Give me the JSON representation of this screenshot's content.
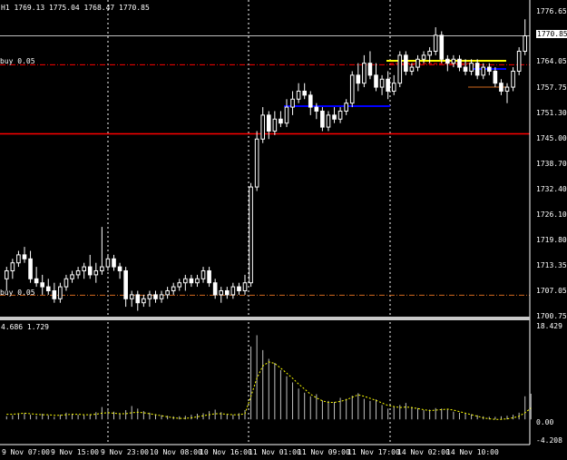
{
  "main": {
    "ohlc_label": "H1  1769.13 1775.04 1768.47 1770.85",
    "order_label_top": "buy 0.05",
    "order_label_bottom": "buy 0.05",
    "current_price": "1770.85",
    "price_ticks": [
      "1776.65",
      "1764.05",
      "1757.75",
      "1751.30",
      "1745.00",
      "1738.70",
      "1732.40",
      "1726.10",
      "1719.80",
      "1713.35",
      "1707.05",
      "1700.75"
    ]
  },
  "indicator": {
    "label": "4.686 1.729",
    "ticks": [
      "18.429",
      "0.00",
      "-4.208"
    ]
  },
  "time_ticks": [
    "9 Nov 07:00",
    "9 Nov 15:00",
    "9 Nov 23:00",
    "10 Nov 08:00",
    "10 Nov 16:00",
    "11 Nov 01:00",
    "11 Nov 09:00",
    "11 Nov 17:00",
    "14 Nov 02:00",
    "14 Nov 10:00"
  ],
  "colors": {
    "background": "#000000",
    "candle": "#ffffff",
    "grid_separator": "#ffffff",
    "red_level": "#ff0000",
    "blue_level": "#0000ff",
    "yellow_level": "#ffff00",
    "brown_level": "#8b4513",
    "orange_dashdot": "#d2691e",
    "indicator_line": "#ffff00",
    "indicator_hist": "#c0c0c0"
  },
  "chart_data": {
    "type": "candlestick",
    "symbol_timeframe": "H1",
    "price_range": [
      1700.75,
      1776.65
    ],
    "horizontal_levels": [
      {
        "price": 1770.85,
        "color": "#c0c0c0",
        "style": "solid"
      },
      {
        "price": 1763.6,
        "color": "#ff0000",
        "style": "dash-dot"
      },
      {
        "price": 1746.3,
        "color": "#ff0000",
        "style": "solid"
      },
      {
        "price": 1705.9,
        "color": "#d2691e",
        "style": "dash-dot"
      }
    ],
    "candles": [
      {
        "o": 1710,
        "h": 1713,
        "l": 1707,
        "c": 1712
      },
      {
        "o": 1712,
        "h": 1715,
        "l": 1710,
        "c": 1714
      },
      {
        "o": 1714,
        "h": 1717,
        "l": 1713,
        "c": 1716
      },
      {
        "o": 1716,
        "h": 1718,
        "l": 1714,
        "c": 1715
      },
      {
        "o": 1715,
        "h": 1717,
        "l": 1709,
        "c": 1710
      },
      {
        "o": 1710,
        "h": 1713,
        "l": 1708,
        "c": 1709
      },
      {
        "o": 1709,
        "h": 1711,
        "l": 1706,
        "c": 1708
      },
      {
        "o": 1708,
        "h": 1710,
        "l": 1706,
        "c": 1707
      },
      {
        "o": 1707,
        "h": 1709,
        "l": 1704,
        "c": 1705
      },
      {
        "o": 1705,
        "h": 1709,
        "l": 1704,
        "c": 1708
      },
      {
        "o": 1708,
        "h": 1711,
        "l": 1707,
        "c": 1710
      },
      {
        "o": 1710,
        "h": 1712,
        "l": 1709,
        "c": 1711
      },
      {
        "o": 1711,
        "h": 1713,
        "l": 1710,
        "c": 1712
      },
      {
        "o": 1712,
        "h": 1714,
        "l": 1710,
        "c": 1713
      },
      {
        "o": 1713,
        "h": 1716,
        "l": 1710,
        "c": 1711
      },
      {
        "o": 1711,
        "h": 1714,
        "l": 1709,
        "c": 1712
      },
      {
        "o": 1712,
        "h": 1723,
        "l": 1711,
        "c": 1713
      },
      {
        "o": 1713,
        "h": 1716,
        "l": 1712,
        "c": 1715
      },
      {
        "o": 1715,
        "h": 1716,
        "l": 1712,
        "c": 1713
      },
      {
        "o": 1713,
        "h": 1714,
        "l": 1710,
        "c": 1712
      },
      {
        "o": 1712,
        "h": 1713,
        "l": 1703,
        "c": 1705
      },
      {
        "o": 1705,
        "h": 1707,
        "l": 1703,
        "c": 1706
      },
      {
        "o": 1706,
        "h": 1707,
        "l": 1702,
        "c": 1704
      },
      {
        "o": 1704,
        "h": 1706,
        "l": 1703,
        "c": 1705
      },
      {
        "o": 1705,
        "h": 1707,
        "l": 1703,
        "c": 1706
      },
      {
        "o": 1706,
        "h": 1707,
        "l": 1704,
        "c": 1705
      },
      {
        "o": 1705,
        "h": 1707,
        "l": 1704,
        "c": 1706
      },
      {
        "o": 1706,
        "h": 1708,
        "l": 1705,
        "c": 1707
      },
      {
        "o": 1707,
        "h": 1709,
        "l": 1706,
        "c": 1708
      },
      {
        "o": 1708,
        "h": 1710,
        "l": 1707,
        "c": 1709
      },
      {
        "o": 1709,
        "h": 1711,
        "l": 1707,
        "c": 1710
      },
      {
        "o": 1710,
        "h": 1711,
        "l": 1708,
        "c": 1709
      },
      {
        "o": 1709,
        "h": 1711,
        "l": 1708,
        "c": 1710
      },
      {
        "o": 1710,
        "h": 1713,
        "l": 1709,
        "c": 1712
      },
      {
        "o": 1712,
        "h": 1713,
        "l": 1708,
        "c": 1709
      },
      {
        "o": 1709,
        "h": 1710,
        "l": 1705,
        "c": 1706
      },
      {
        "o": 1706,
        "h": 1708,
        "l": 1704,
        "c": 1707
      },
      {
        "o": 1707,
        "h": 1708,
        "l": 1705,
        "c": 1706
      },
      {
        "o": 1706,
        "h": 1709,
        "l": 1705,
        "c": 1708
      },
      {
        "o": 1708,
        "h": 1709,
        "l": 1706,
        "c": 1707
      },
      {
        "o": 1707,
        "h": 1711,
        "l": 1706,
        "c": 1709
      },
      {
        "o": 1709,
        "h": 1734,
        "l": 1708,
        "c": 1733
      },
      {
        "o": 1733,
        "h": 1747,
        "l": 1732,
        "c": 1745
      },
      {
        "o": 1745,
        "h": 1753,
        "l": 1744,
        "c": 1751
      },
      {
        "o": 1751,
        "h": 1752,
        "l": 1745,
        "c": 1747
      },
      {
        "o": 1747,
        "h": 1752,
        "l": 1746,
        "c": 1750
      },
      {
        "o": 1750,
        "h": 1752,
        "l": 1748,
        "c": 1749
      },
      {
        "o": 1749,
        "h": 1755,
        "l": 1748,
        "c": 1753
      },
      {
        "o": 1753,
        "h": 1757,
        "l": 1751,
        "c": 1755
      },
      {
        "o": 1755,
        "h": 1759,
        "l": 1754,
        "c": 1757
      },
      {
        "o": 1757,
        "h": 1759,
        "l": 1755,
        "c": 1756
      },
      {
        "o": 1756,
        "h": 1757,
        "l": 1751,
        "c": 1753
      },
      {
        "o": 1753,
        "h": 1754,
        "l": 1750,
        "c": 1752
      },
      {
        "o": 1752,
        "h": 1753,
        "l": 1747,
        "c": 1748
      },
      {
        "o": 1748,
        "h": 1752,
        "l": 1747,
        "c": 1751
      },
      {
        "o": 1751,
        "h": 1753,
        "l": 1749,
        "c": 1750
      },
      {
        "o": 1750,
        "h": 1753,
        "l": 1749,
        "c": 1752
      },
      {
        "o": 1752,
        "h": 1755,
        "l": 1751,
        "c": 1754
      },
      {
        "o": 1754,
        "h": 1762,
        "l": 1753,
        "c": 1761
      },
      {
        "o": 1761,
        "h": 1764,
        "l": 1757,
        "c": 1759
      },
      {
        "o": 1759,
        "h": 1766,
        "l": 1758,
        "c": 1764
      },
      {
        "o": 1764,
        "h": 1767,
        "l": 1760,
        "c": 1761
      },
      {
        "o": 1761,
        "h": 1764,
        "l": 1757,
        "c": 1758
      },
      {
        "o": 1758,
        "h": 1761,
        "l": 1756,
        "c": 1760
      },
      {
        "o": 1760,
        "h": 1762,
        "l": 1755,
        "c": 1757
      },
      {
        "o": 1757,
        "h": 1761,
        "l": 1756,
        "c": 1759
      },
      {
        "o": 1759,
        "h": 1767,
        "l": 1758,
        "c": 1766
      },
      {
        "o": 1766,
        "h": 1767,
        "l": 1761,
        "c": 1762
      },
      {
        "o": 1762,
        "h": 1764,
        "l": 1761,
        "c": 1763
      },
      {
        "o": 1763,
        "h": 1766,
        "l": 1762,
        "c": 1765
      },
      {
        "o": 1765,
        "h": 1767,
        "l": 1764,
        "c": 1766
      },
      {
        "o": 1766,
        "h": 1768,
        "l": 1764,
        "c": 1767
      },
      {
        "o": 1767,
        "h": 1773,
        "l": 1766,
        "c": 1771
      },
      {
        "o": 1771,
        "h": 1772,
        "l": 1764,
        "c": 1765
      },
      {
        "o": 1765,
        "h": 1766,
        "l": 1762,
        "c": 1764
      },
      {
        "o": 1764,
        "h": 1766,
        "l": 1763,
        "c": 1765
      },
      {
        "o": 1765,
        "h": 1766,
        "l": 1762,
        "c": 1763
      },
      {
        "o": 1763,
        "h": 1765,
        "l": 1761,
        "c": 1762
      },
      {
        "o": 1762,
        "h": 1765,
        "l": 1761,
        "c": 1764
      },
      {
        "o": 1764,
        "h": 1765,
        "l": 1760,
        "c": 1761
      },
      {
        "o": 1761,
        "h": 1764,
        "l": 1760,
        "c": 1763
      },
      {
        "o": 1763,
        "h": 1764,
        "l": 1761,
        "c": 1762
      },
      {
        "o": 1762,
        "h": 1763,
        "l": 1758,
        "c": 1759
      },
      {
        "o": 1759,
        "h": 1760,
        "l": 1756,
        "c": 1757
      },
      {
        "o": 1757,
        "h": 1759,
        "l": 1754,
        "c": 1758
      },
      {
        "o": 1758,
        "h": 1763,
        "l": 1757,
        "c": 1762
      },
      {
        "o": 1762,
        "h": 1768,
        "l": 1761,
        "c": 1767
      },
      {
        "o": 1767,
        "h": 1775,
        "l": 1766,
        "c": 1770.85
      }
    ],
    "indicator": {
      "range": [
        -4.208,
        18.429
      ],
      "histogram": [
        0.6,
        0.8,
        1.0,
        1.2,
        0.9,
        0.7,
        1.1,
        0.8,
        0.5,
        0.9,
        1.3,
        1.1,
        0.9,
        0.8,
        1.0,
        1.4,
        2.4,
        1.9,
        1.5,
        1.2,
        1.8,
        2.6,
        2.1,
        1.6,
        1.3,
        1.0,
        0.8,
        0.7,
        0.6,
        0.6,
        0.7,
        0.9,
        1.1,
        1.2,
        1.6,
        1.9,
        1.4,
        1.0,
        0.9,
        1.2,
        1.8,
        14.2,
        16.4,
        13.5,
        11.8,
        11.0,
        9.6,
        8.4,
        7.2,
        6.0,
        5.2,
        4.5,
        4.9,
        3.7,
        3.6,
        3.4,
        4.2,
        4.0,
        4.6,
        5.1,
        4.0,
        3.6,
        3.9,
        2.8,
        2.1,
        2.5,
        2.8,
        3.2,
        2.4,
        2.2,
        1.8,
        1.9,
        2.2,
        2.1,
        1.9,
        1.5,
        1.3,
        1.1,
        1.0,
        0.8,
        0.6,
        0.5,
        0.5,
        0.6,
        0.7,
        0.9,
        1.3,
        4.5,
        5.0
      ],
      "signal": [
        1.0,
        1.0,
        1.1,
        1.2,
        1.1,
        1.0,
        0.9,
        0.9,
        0.8,
        0.8,
        0.9,
        1.0,
        1.0,
        0.9,
        0.9,
        1.0,
        1.2,
        1.3,
        1.2,
        1.1,
        1.1,
        1.3,
        1.4,
        1.3,
        1.1,
        0.9,
        0.7,
        0.5,
        0.3,
        0.2,
        0.2,
        0.3,
        0.5,
        0.7,
        0.9,
        1.1,
        1.1,
        1.0,
        0.9,
        0.9,
        1.1,
        4.5,
        8.0,
        10.4,
        11.2,
        10.9,
        10.0,
        9.0,
        8.0,
        6.9,
        5.9,
        4.9,
        4.2,
        3.6,
        3.3,
        3.3,
        3.5,
        3.8,
        4.3,
        4.8,
        4.5,
        4.1,
        3.7,
        3.2,
        2.7,
        2.5,
        2.3,
        2.4,
        2.3,
        2.1,
        1.9,
        1.7,
        1.8,
        1.9,
        2.0,
        1.8,
        1.5,
        1.2,
        0.9,
        0.6,
        0.3,
        0.1,
        0.0,
        0.0,
        0.1,
        0.3,
        0.6,
        1.3,
        2.2
      ]
    }
  }
}
